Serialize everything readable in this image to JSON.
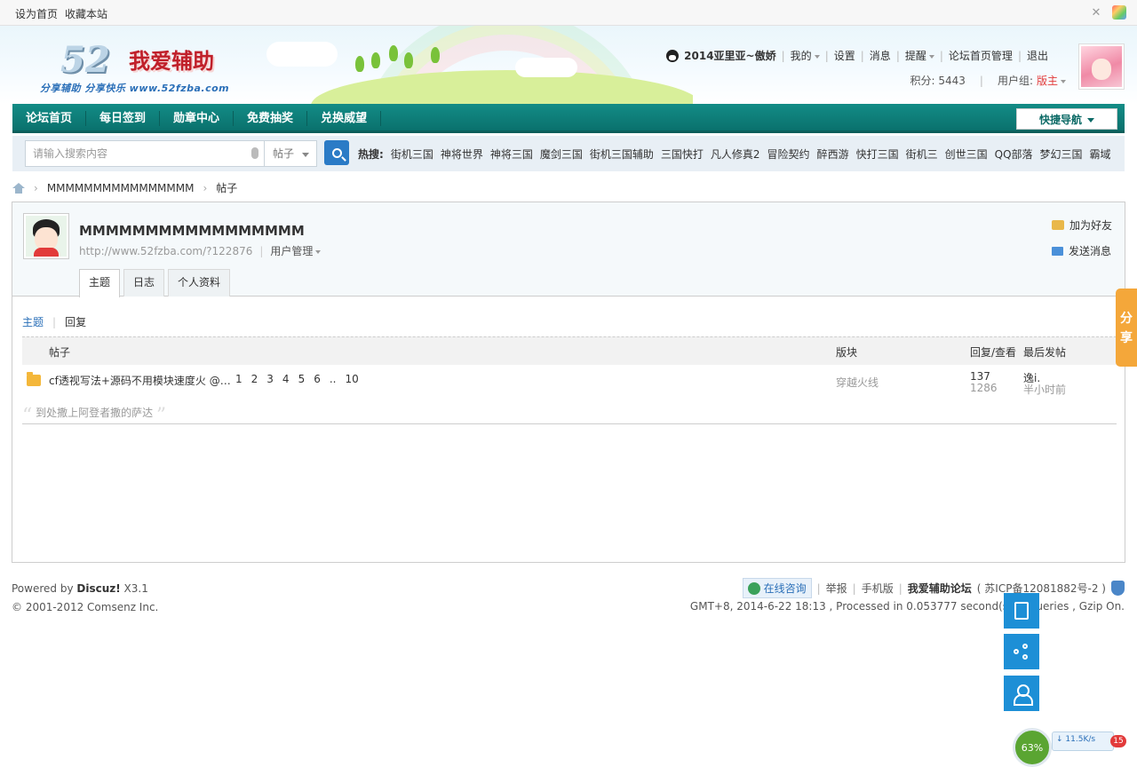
{
  "topbar": {
    "links": [
      "设为首页",
      "收藏本站"
    ],
    "icons": [
      "collapse-icon",
      "color-scheme-icon"
    ]
  },
  "header": {
    "logo_number": "52",
    "logo_text": "我爱辅助",
    "slogan": "分享辅助  分享快乐  www.52fzba.com",
    "user": {
      "name": "2014亚里亚~傲娇",
      "menu": [
        "我的",
        "设置",
        "消息",
        "提醒",
        "论坛首页管理",
        "退出"
      ],
      "points_label": "积分: 5443",
      "group_label": "用户组:",
      "group_value": "版主"
    }
  },
  "nav": {
    "items": [
      "论坛首页",
      "每日签到",
      "勋章中心",
      "免费抽奖",
      "兑换威望"
    ],
    "quick_nav": "快捷导航"
  },
  "search": {
    "placeholder": "请输入搜索内容",
    "type": "帖子",
    "hot_label": "热搜:",
    "hot": [
      "街机三国",
      "神将世界",
      "神将三国",
      "魔剑三国",
      "街机三国辅助",
      "三国快打",
      "凡人修真2",
      "冒险契约",
      "醉西游",
      "快打三国",
      "街机三",
      "创世三国",
      "QQ部落",
      "梦幻三国",
      "霸域"
    ]
  },
  "breadcrumb": {
    "user": "MMMMMMMMMMMMMMMM",
    "page": "帖子"
  },
  "profile": {
    "name": "MMMMMMMMMMMMMMMMM",
    "url": "http://www.52fzba.com/?122876",
    "manage": "用户管理",
    "add_friend": "加为好友",
    "send_msg": "发送消息",
    "tabs": [
      "主题",
      "日志",
      "个人资料"
    ],
    "subtabs": [
      "主题",
      "回复"
    ]
  },
  "table": {
    "headers": {
      "post": "帖子",
      "forum": "版块",
      "reply_view": "回复/查看",
      "last": "最后发帖"
    },
    "rows": [
      {
        "title": "cf透视写法+源码不用模块速度火 @…",
        "pages": [
          "1",
          "2",
          "3",
          "4",
          "5",
          "6",
          "..",
          "10"
        ],
        "forum": "穿越火线",
        "replies": "137",
        "views": "1286",
        "last_user": "逸i.",
        "last_time": "半小时前"
      }
    ],
    "quote": "到处撒上阿登者撒的萨达"
  },
  "footer": {
    "powered_prefix": "Powered by ",
    "brand": "Discuz!",
    "version": " X3.1",
    "copyright": "© 2001-2012 Comsenz Inc.",
    "consult": "在线咨询",
    "report": "举报",
    "mobile": "手机版",
    "site": "我爱辅助论坛",
    "icp": "( 苏ICP备12081882号-2 )",
    "stats": "GMT+8, 2014-6-22 18:13 , Processed in 0.053777 second(s), 7 queries , Gzip On."
  },
  "share_tab": [
    "分",
    "享"
  ],
  "speed_widget": {
    "percent": "63%",
    "rate": "11.5K/s",
    "badge": "15"
  }
}
